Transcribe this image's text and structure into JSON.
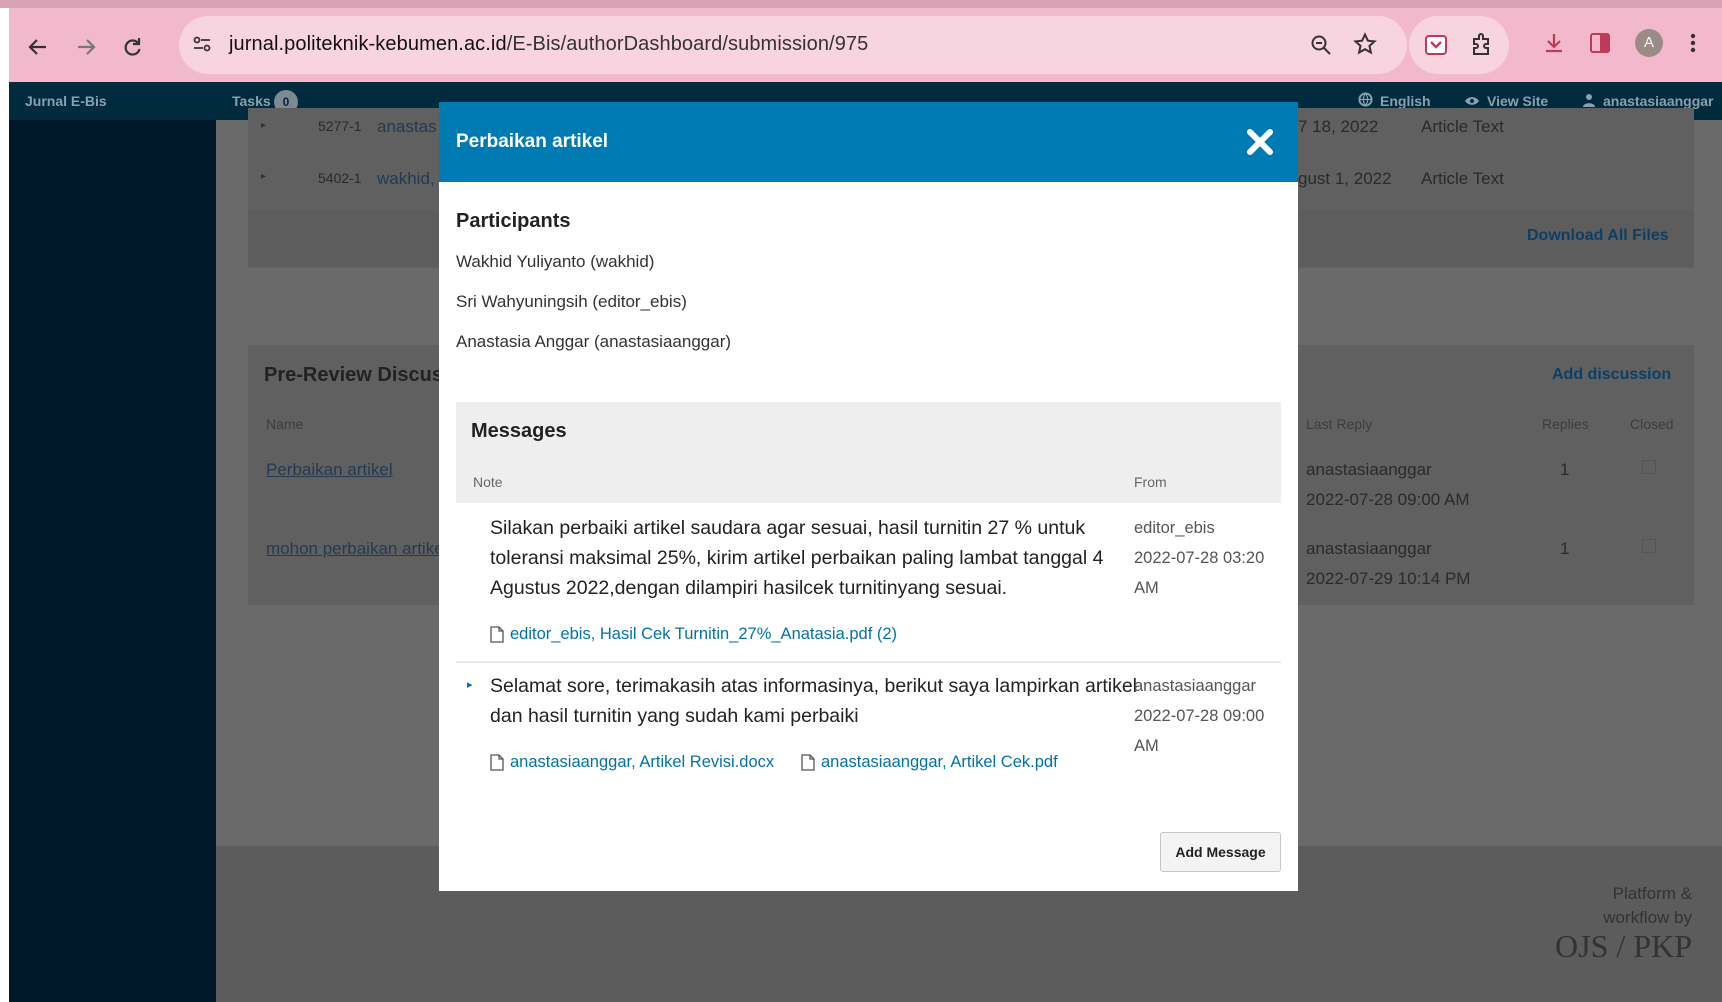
{
  "browser": {
    "url_host": "jurnal.politeknik-kebumen.ac.id",
    "url_path": "/E-Bis/authorDashboard/submission/975",
    "profile_initial": "A"
  },
  "app_header": {
    "journal_name": "Jurnal E-Bis",
    "tasks_label": "Tasks",
    "tasks_count": "0",
    "language": "English",
    "view_site": "View Site",
    "username": "anastasiaanggar"
  },
  "background": {
    "file_rows": [
      {
        "id": "5277-1",
        "name": "anastas",
        "date": "7 18, 2022",
        "type": "Article Text"
      },
      {
        "id": "5402-1",
        "name": "wakhid,",
        "date": "gust 1, 2022",
        "type": "Article Text"
      }
    ],
    "download_all": "Download All Files",
    "discussion_title": "Pre-Review Discussio",
    "add_discussion": "Add discussion",
    "columns": {
      "name": "Name",
      "last_reply": "Last Reply",
      "replies": "Replies",
      "closed": "Closed"
    },
    "discussions": [
      {
        "name": "Perbaikan artikel",
        "last_user": "anastasiaanggar",
        "last_time": "2022-07-28 09:00 AM",
        "replies": "1"
      },
      {
        "name": "mohon perbaikan artike",
        "last_user": "anastasiaanggar",
        "last_time": "2022-07-29 10:14 PM",
        "replies": "1"
      }
    ],
    "footer_line1": "Platform &",
    "footer_line2": "workflow by",
    "footer_logo": "OJS / PKP"
  },
  "modal": {
    "title": "Perbaikan artikel",
    "participants_title": "Participants",
    "participants": [
      "Wakhid Yuliyanto (wakhid)",
      "Sri Wahyuningsih (editor_ebis)",
      "Anastasia Anggar (anastasiaanggar)"
    ],
    "messages_title": "Messages",
    "col_note": "Note",
    "col_from": "From",
    "messages": [
      {
        "text_lines": [
          "Silakan perbaiki artikel saudara agar sesuai, hasil turnitin 27 % untuk",
          "toleransi maksimal 25%, kirim artikel perbaikan paling lambat tanggal 4",
          "Agustus 2022,dengan dilampiri hasilcek turnitinyang sesuai."
        ],
        "from_lines": [
          "editor_ebis",
          "2022-07-28 03:20",
          "AM"
        ],
        "attachments": [
          "editor_ebis, Hasil Cek Turnitin_27%_Anatasia.pdf (2)"
        ]
      },
      {
        "text_lines": [
          "Selamat sore, terimakasih atas informasinya, berikut saya lampirkan artikel",
          "dan hasil turnitin yang sudah kami perbaiki"
        ],
        "from_lines": [
          "anastasiaanggar",
          "2022-07-28 09:00",
          "AM"
        ],
        "attachments": [
          "anastasiaanggar, Artikel Revisi.docx",
          "anastasiaanggar, Artikel Cek.pdf"
        ]
      }
    ],
    "add_message": "Add Message"
  },
  "colors": {
    "modal_header": "#007ab2",
    "link": "#0073a8",
    "chrome": "#f2b8cc"
  }
}
